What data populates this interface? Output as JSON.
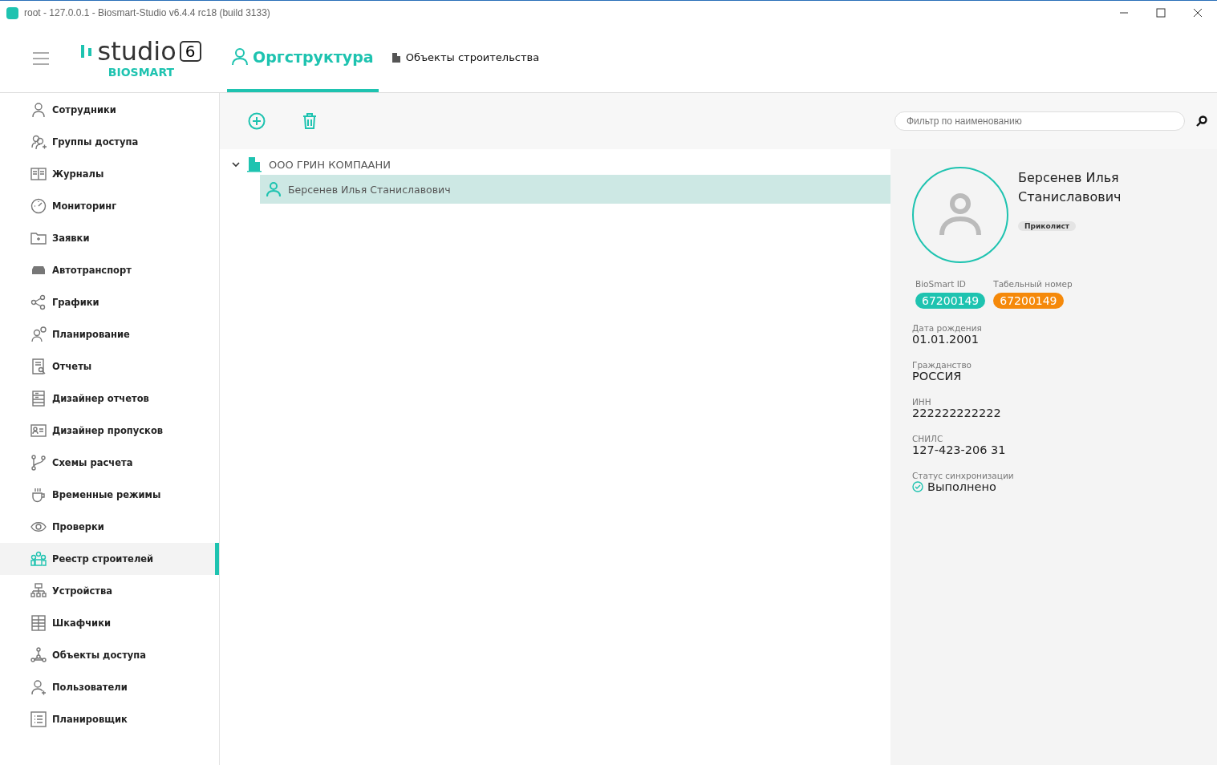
{
  "window": {
    "title": "root - 127.0.0.1 - Biosmart-Studio v6.4.4 rc18 (build 3133)"
  },
  "logo": {
    "word": "studio",
    "version": "6",
    "brand": "BIOSMART"
  },
  "tabs": [
    {
      "label": "Оргструктура",
      "selected": true
    },
    {
      "label": "Объекты строительства",
      "selected": false
    }
  ],
  "sidebar": {
    "items": [
      {
        "label": "Сотрудники",
        "selected": false
      },
      {
        "label": "Группы доступа",
        "selected": false
      },
      {
        "label": "Журналы",
        "selected": false
      },
      {
        "label": "Мониторинг",
        "selected": false
      },
      {
        "label": "Заявки",
        "selected": false
      },
      {
        "label": "Автотранспорт",
        "selected": false
      },
      {
        "label": "Графики",
        "selected": false
      },
      {
        "label": "Планирование",
        "selected": false
      },
      {
        "label": "Отчеты",
        "selected": false
      },
      {
        "label": "Дизайнер отчетов",
        "selected": false
      },
      {
        "label": "Дизайнер пропусков",
        "selected": false
      },
      {
        "label": "Схемы расчета",
        "selected": false
      },
      {
        "label": "Временные режимы",
        "selected": false
      },
      {
        "label": "Проверки",
        "selected": false
      },
      {
        "label": "Реестр строителей",
        "selected": true
      },
      {
        "label": "Устройства",
        "selected": false
      },
      {
        "label": "Шкафчики",
        "selected": false
      },
      {
        "label": "Объекты доступа",
        "selected": false
      },
      {
        "label": "Пользователи",
        "selected": false
      },
      {
        "label": "Планировщик",
        "selected": false
      }
    ]
  },
  "filter": {
    "placeholder": "Фильтр по наименованию"
  },
  "tree": [
    {
      "label": "ООО ГРИН КОМПААНИ",
      "expanded": true,
      "selected": false,
      "children": [
        {
          "label": "Берсенев Илья Станиславович",
          "selected": true
        }
      ]
    }
  ],
  "details": {
    "name": "Берсенев Илья Станиславович",
    "tag": "Приколист",
    "ids": [
      {
        "label": "BioSmart ID",
        "value": "67200149",
        "color": "#1ec3b0"
      },
      {
        "label": "Табельный номер",
        "value": "67200149",
        "color": "#f5890a"
      }
    ],
    "fields": [
      {
        "label": "Дата рождения",
        "value": "01.01.2001"
      },
      {
        "label": "Гражданство",
        "value": "РОССИЯ"
      },
      {
        "label": "ИНН",
        "value": "222222222222"
      },
      {
        "label": "СНИЛС",
        "value": "127-423-206 31"
      }
    ],
    "sync": {
      "label": "Статус синхронизации",
      "value": "Выполнено"
    }
  }
}
